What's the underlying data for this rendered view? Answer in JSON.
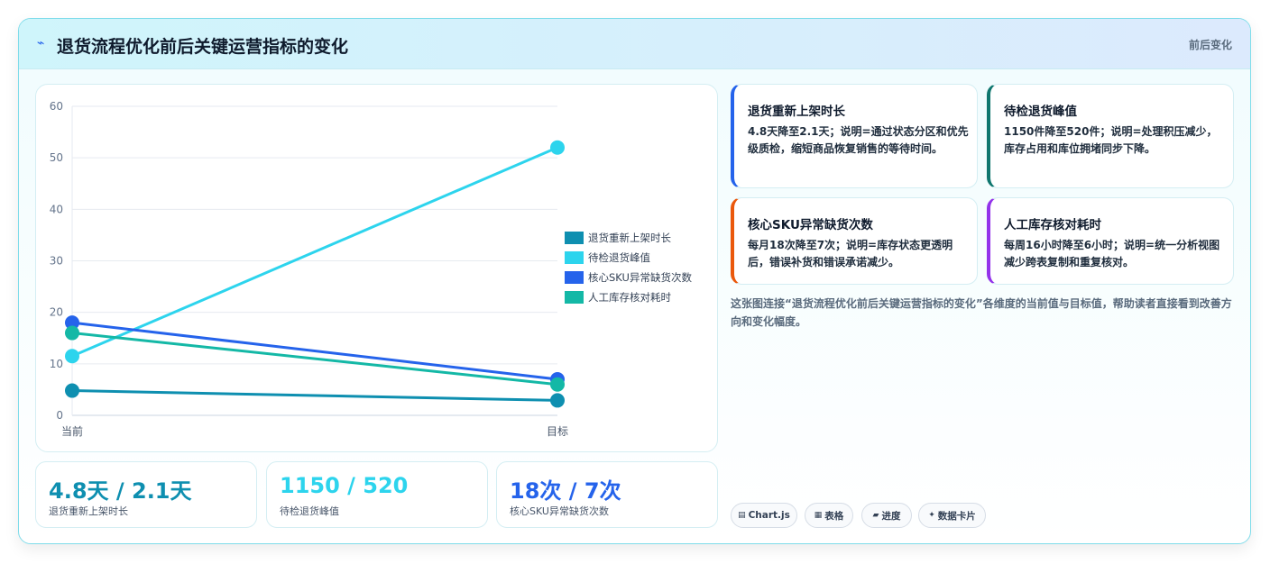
{
  "header": {
    "title": "退货流程优化前后关键运营指标的变化",
    "tag": "前后变化",
    "icon": "sparkline-icon"
  },
  "chart_data": {
    "type": "line",
    "categories": [
      "当前",
      "目标"
    ],
    "ylim": [
      0,
      60
    ],
    "yticks": [
      0,
      10,
      20,
      30,
      40,
      50,
      60
    ],
    "grid": true,
    "legend_position": "right",
    "series": [
      {
        "name": "退货重新上架时长",
        "values": [
          4.8,
          2.9
        ],
        "color": "#0e8fb0"
      },
      {
        "name": "待检退货峰值",
        "values": [
          11.5,
          52
        ],
        "color": "#2dd4ed"
      },
      {
        "name": "核心SKU异常缺货次数",
        "values": [
          18,
          7
        ],
        "color": "#2563eb"
      },
      {
        "name": "人工库存核对耗时",
        "values": [
          16,
          6
        ],
        "color": "#14b8a6"
      }
    ]
  },
  "kpis": [
    {
      "value": "4.8天 / 2.1天",
      "label": "退货重新上架时长",
      "color": "#0e8fb0"
    },
    {
      "value": "1150 / 520",
      "label": "待检退货峰值",
      "color": "#2dd4ed"
    },
    {
      "value": "18次 / 7次",
      "label": "核心SKU异常缺货次数",
      "color": "#2563eb"
    }
  ],
  "info_cards": [
    {
      "title": "退货重新上架时长",
      "desc": "4.8天降至2.1天；说明=通过状态分区和优先级质检，缩短商品恢复销售的等待时间。",
      "accent": "#2563eb"
    },
    {
      "title": "待检退货峰值",
      "desc": "1150件降至520件；说明=处理积压减少，库存占用和库位拥堵同步下降。",
      "accent": "#0f766e"
    },
    {
      "title": "核心SKU异常缺货次数",
      "desc": "每月18次降至7次；说明=库存状态更透明后，错误补货和错误承诺减少。",
      "accent": "#ea580c"
    },
    {
      "title": "人工库存核对耗时",
      "desc": "每周16小时降至6小时；说明=统一分析视图减少跨表复制和重复核对。",
      "accent": "#9333ea"
    }
  ],
  "note": "这张图连接“退货流程优化前后关键运营指标的变化”各维度的当前值与目标值，帮助读者直接看到改善方向和变化幅度。",
  "chips": [
    {
      "icon": "▤",
      "label": "Chart.js"
    },
    {
      "icon": "▦",
      "label": "表格"
    },
    {
      "icon": "▰",
      "label": "进度"
    },
    {
      "icon": "✦",
      "label": "数据卡片"
    }
  ]
}
